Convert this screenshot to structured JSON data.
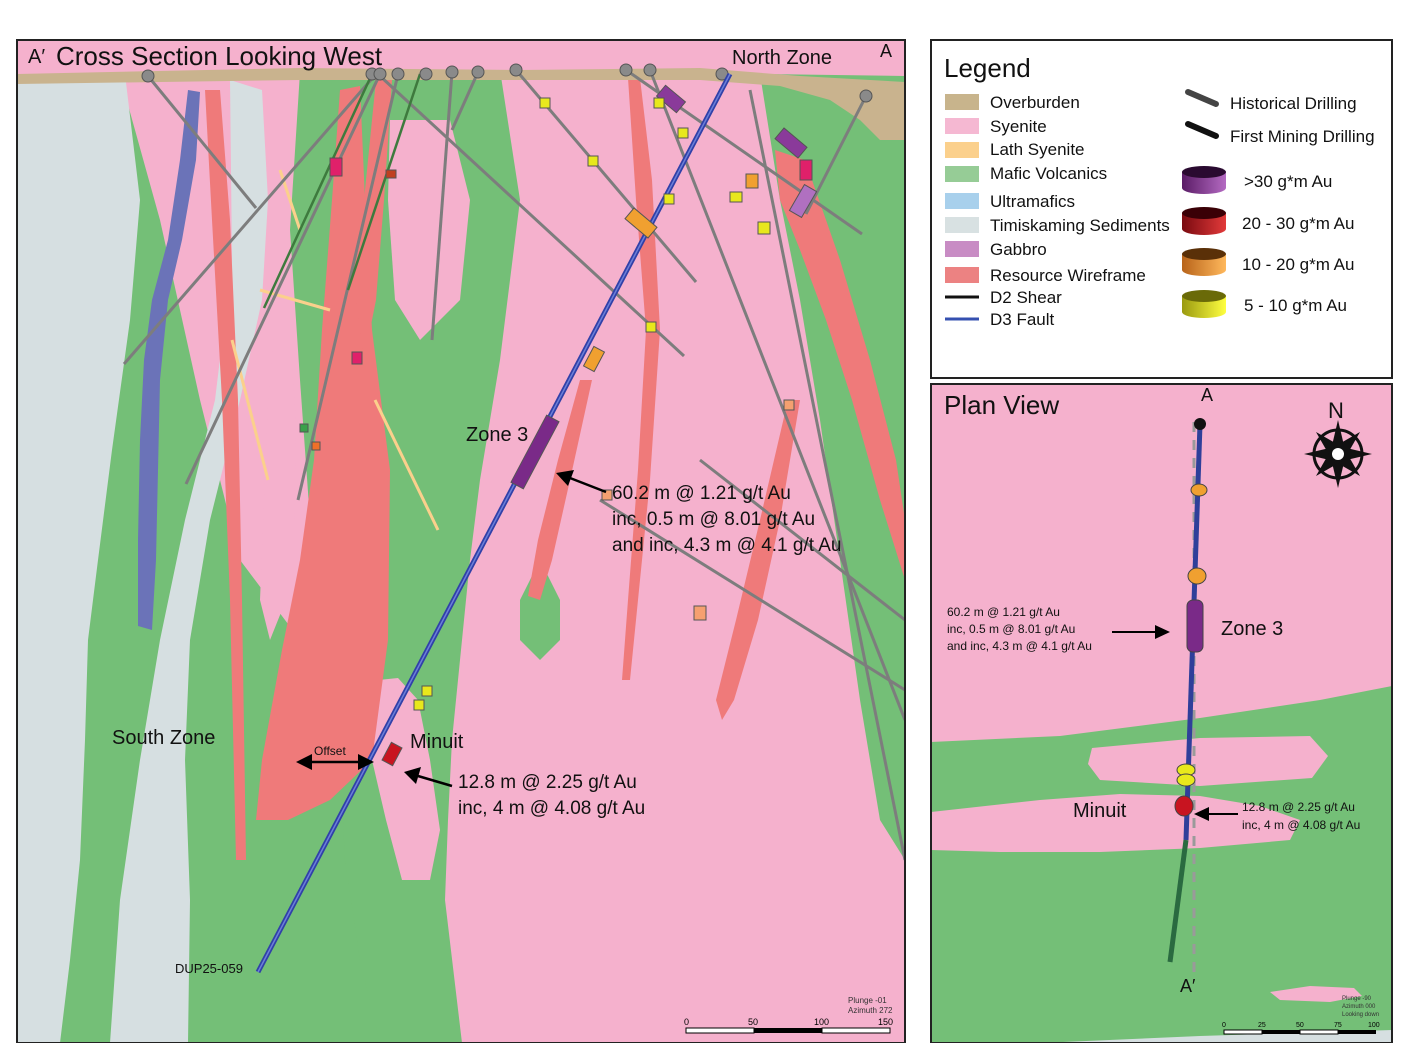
{
  "cross_section": {
    "title": "Cross Section Looking West",
    "corner_left": "A′",
    "corner_right": "A",
    "labels": {
      "north_zone": "North Zone",
      "south_zone": "South Zone",
      "zone3": "Zone 3",
      "minuit": "Minuit",
      "offset": "Offset",
      "hole_id": "DUP25-059"
    },
    "annotation_zone3": [
      "60.2 m @ 1.21 g/t Au",
      "inc, 0.5 m @ 8.01 g/t Au",
      "and inc, 4.3 m @ 4.1 g/t Au"
    ],
    "annotation_minuit": [
      "12.8 m @ 2.25 g/t Au",
      "inc, 4 m @ 4.08 g/t Au"
    ],
    "view_info": [
      "Plunge -01",
      "Azimuth 272"
    ],
    "scale": {
      "ticks": [
        "0",
        "50",
        "100",
        "150"
      ]
    }
  },
  "legend": {
    "title": "Legend",
    "units": [
      {
        "label": "Overburden",
        "color": "#c8b48c"
      },
      {
        "label": "Syenite",
        "color": "#f5b8d2"
      },
      {
        "label": "Lath Syenite",
        "color": "#fbd08c"
      },
      {
        "label": "Mafic Volcanics",
        "color": "#96cc96"
      },
      {
        "label": "Ultramafics",
        "color": "#a8d0ec"
      },
      {
        "label": "Timiskaming Sediments",
        "color": "#d8e1e2"
      },
      {
        "label": "Gabbro",
        "color": "#c88cc4"
      },
      {
        "label": "Resource Wireframe",
        "color": "#ec8282"
      }
    ],
    "lines": [
      {
        "label": "D2 Shear",
        "color": "#111111"
      },
      {
        "label": "D3 Fault",
        "color": "#3550b0"
      }
    ],
    "drilling": [
      {
        "label": "Historical Drilling",
        "color": "#444444"
      },
      {
        "label": "First Mining Drilling",
        "color": "#111111"
      }
    ],
    "grades": [
      {
        "label": ">30 g*m Au",
        "color": "#7a2a88"
      },
      {
        "label": "20 - 30 g*m Au",
        "color": "#b0101c"
      },
      {
        "label": "10 - 20 g*m Au",
        "color": "#e88a24"
      },
      {
        "label": "5 - 10 g*m Au",
        "color": "#d8d81c"
      }
    ]
  },
  "plan_view": {
    "title": "Plan View",
    "north": "N",
    "label_top": "A",
    "label_bottom": "A′",
    "zone3": "Zone 3",
    "minuit": "Minuit",
    "annotation_zone3": [
      "60.2 m @ 1.21 g/t Au",
      "inc, 0.5 m @ 8.01 g/t Au",
      "and inc, 4.3 m @ 4.1 g/t Au"
    ],
    "annotation_minuit": [
      "12.8 m @ 2.25 g/t Au",
      "inc, 4 m @ 4.08 g/t Au"
    ],
    "view_info": [
      "Plunge -90",
      "Azimuth 000",
      "Looking down"
    ],
    "scale": {
      "ticks": [
        "0",
        "25",
        "50",
        "75",
        "100"
      ]
    }
  }
}
